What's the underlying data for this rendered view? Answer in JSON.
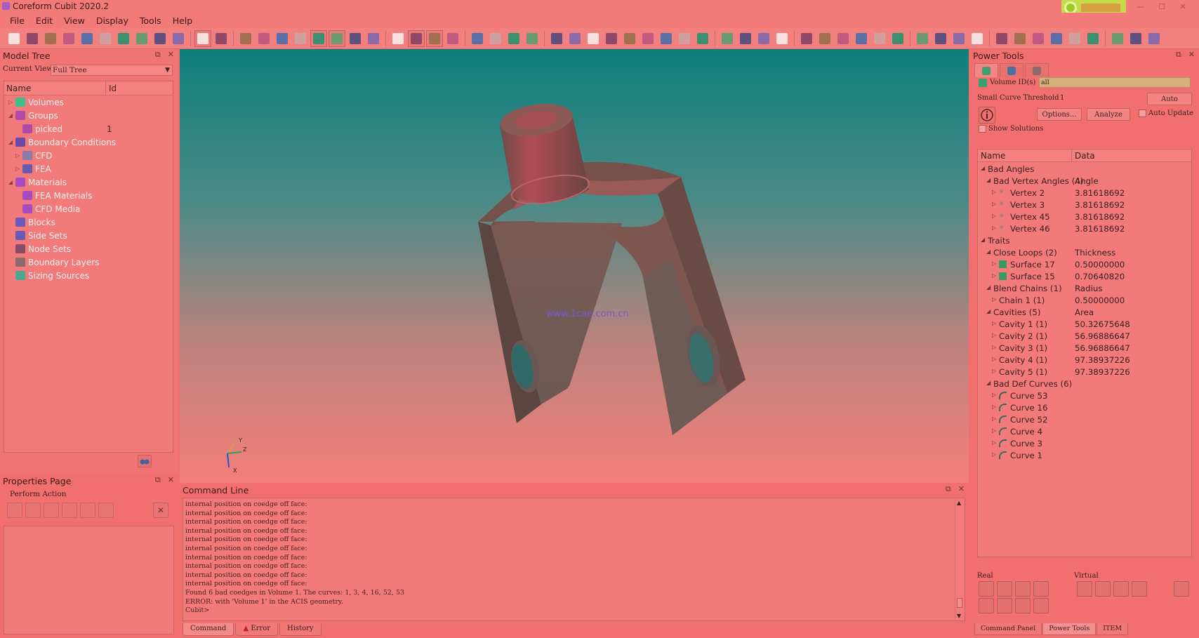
{
  "app": {
    "title": "Coreform Cubit 2020.2"
  },
  "colors": {
    "chrome": "#f27a78",
    "viewport_top": "#0e7f7c",
    "part": "#8b5a52",
    "watermark": "#6d5bd6",
    "highlight_input": "#d5b07a"
  },
  "menu": [
    "File",
    "Edit",
    "View",
    "Display",
    "Tools",
    "Help"
  ],
  "toolbar_icons": [
    "new-file-icon",
    "open-file-icon",
    "save-icon",
    "save-as-icon",
    "export-icon",
    "journal-icon",
    "play-journal-icon",
    "record-icon",
    "stop-icon",
    "settings-icon",
    "select-icon",
    "undo-icon",
    "view-iso-icon",
    "view-front-icon",
    "view-back-icon",
    "view-top-icon",
    "view-bottom-icon",
    "view-left-icon",
    "view-right-icon",
    "view-rotate-icon",
    "mesh-grid-icon",
    "shaded-icon",
    "hidden-line-icon",
    "refresh-icon",
    "zoom-in-icon",
    "zoom-out-icon",
    "fit-icon",
    "perspective-icon",
    "cut-icon",
    "volume-icon",
    "surface-icon",
    "curve-icon",
    "vertex-icon",
    "group-icon",
    "block-icon",
    "sideset-icon",
    "nodeset-icon",
    "pick-volume-icon",
    "pick-surface-icon",
    "pick-curve-icon",
    "pick-vertex-icon",
    "crosshair-icon",
    "line-icon",
    "box-icon",
    "brick-icon",
    "mesh-icon",
    "boundary-icon",
    "axis-icon",
    "arrow-icon",
    "measure-icon",
    "thermo-icon",
    "labels-icon",
    "text-icon",
    "check-icon",
    "minus-icon",
    "dash-icon",
    "fit-window-icon",
    "grid-icon",
    "cube-icon",
    "clear-icon"
  ],
  "model_tree": {
    "title": "Model Tree",
    "current_view_label": "Current View",
    "current_view_value": "Full Tree",
    "columns": [
      "Name",
      "Id"
    ],
    "items": [
      {
        "label": "Volumes",
        "expander": "▷",
        "icon": "volume-icon",
        "color": "#3fbf8a",
        "id": ""
      },
      {
        "label": "Groups",
        "expander": "◢",
        "icon": "group-icon",
        "color": "#b04aa8",
        "id": ""
      },
      {
        "label": "picked",
        "expander": "",
        "icon": "group-icon",
        "color": "#b04aa8",
        "id": "1"
      },
      {
        "label": "Boundary Conditions",
        "expander": "◢",
        "icon": "bc-icon",
        "color": "#6a4aa8",
        "id": ""
      },
      {
        "label": "CFD",
        "expander": "▷",
        "icon": "cfd-icon",
        "color": "#8a7aa8",
        "id": ""
      },
      {
        "label": "FEA",
        "expander": "▷",
        "icon": "fea-icon",
        "color": "#6a5ab0",
        "id": ""
      },
      {
        "label": "Materials",
        "expander": "◢",
        "icon": "materials-icon",
        "color": "#a84ac0",
        "id": ""
      },
      {
        "label": "FEA Materials",
        "expander": "",
        "icon": "fea-material-icon",
        "color": "#a84ac0",
        "id": ""
      },
      {
        "label": "CFD Media",
        "expander": "",
        "icon": "cfd-media-icon",
        "color": "#a84ac0",
        "id": ""
      },
      {
        "label": "Blocks",
        "expander": "",
        "icon": "blocks-icon",
        "color": "#6a5ab8",
        "id": ""
      },
      {
        "label": "Side Sets",
        "expander": "",
        "icon": "sidesets-icon",
        "color": "#6a5ab8",
        "id": ""
      },
      {
        "label": "Node Sets",
        "expander": "",
        "icon": "nodesets-icon",
        "color": "#8a4a6a",
        "id": ""
      },
      {
        "label": "Boundary Layers",
        "expander": "",
        "icon": "boundary-layers-icon",
        "color": "#8a6a6a",
        "id": ""
      },
      {
        "label": "Sizing Sources",
        "expander": "",
        "icon": "sizing-icon",
        "color": "#4aa890",
        "id": ""
      }
    ]
  },
  "properties": {
    "title": "Properties Page",
    "action_label": "Perform Action"
  },
  "viewport": {
    "watermark": "www.1cae.com.cn",
    "axes": {
      "y": "Y",
      "z": "Z",
      "x": "X"
    }
  },
  "command_line": {
    "title": "Command Line",
    "lines": [
      "internal position on coedge off face:",
      "internal position on coedge off face:",
      "internal position on coedge off face:",
      "internal position on coedge off face:",
      "internal position on coedge off face:",
      "internal position on coedge off face:",
      "internal position on coedge off face:",
      "internal position on coedge off face:",
      "internal position on coedge off face:",
      "internal position on coedge off face:",
      "Found 6 bad coedges in Volume 1. The curves: 1, 3, 4, 16, 52, 53",
      "ERROR: with 'Volume 1' in the ACIS geometry.",
      "Cubit>"
    ],
    "tabs": [
      "Command",
      "Error",
      "History"
    ]
  },
  "power_tools": {
    "title": "Power Tools",
    "volume_label": "Volume ID(s)",
    "volume_value": "all",
    "small_curve_label": "Small Curve Threshold",
    "small_curve_value": "1",
    "auto_btn": "Auto",
    "options_btn": "Options...",
    "analyze_btn": "Analyze",
    "auto_update_label": "Auto Update",
    "show_solutions_label": "Show Solutions",
    "columns": [
      "Name",
      "Data"
    ],
    "rows": [
      {
        "name": "Bad Angles",
        "data": "",
        "level": 0,
        "tri": "◢",
        "icon": ""
      },
      {
        "name": "Bad Vertex Angles (4)",
        "data": "Angle",
        "level": 1,
        "tri": "◢",
        "icon": ""
      },
      {
        "name": "Vertex 2",
        "data": "3.81618692",
        "level": 2,
        "tri": "▷",
        "icon": "vertex-icon"
      },
      {
        "name": "Vertex 3",
        "data": "3.81618692",
        "level": 2,
        "tri": "▷",
        "icon": "vertex-icon"
      },
      {
        "name": "Vertex 45",
        "data": "3.81618692",
        "level": 2,
        "tri": "▷",
        "icon": "vertex-icon"
      },
      {
        "name": "Vertex 46",
        "data": "3.81618692",
        "level": 2,
        "tri": "▷",
        "icon": "vertex-icon"
      },
      {
        "name": "Traits",
        "data": "",
        "level": 0,
        "tri": "◢",
        "icon": ""
      },
      {
        "name": "Close Loops (2)",
        "data": "Thickness",
        "level": 1,
        "tri": "◢",
        "icon": ""
      },
      {
        "name": "Surface 17",
        "data": "0.50000000",
        "level": 2,
        "tri": "▷",
        "icon": "surface-icon"
      },
      {
        "name": "Surface 15",
        "data": "0.70640820",
        "level": 2,
        "tri": "▷",
        "icon": "surface-icon"
      },
      {
        "name": "Blend Chains (1)",
        "data": "Radius",
        "level": 1,
        "tri": "◢",
        "icon": ""
      },
      {
        "name": "Chain 1 (1)",
        "data": "0.50000000",
        "level": 2,
        "tri": "▷",
        "icon": ""
      },
      {
        "name": "Cavities (5)",
        "data": "Area",
        "level": 1,
        "tri": "◢",
        "icon": ""
      },
      {
        "name": "Cavity 1 (1)",
        "data": "50.32675648",
        "level": 2,
        "tri": "▷",
        "icon": ""
      },
      {
        "name": "Cavity 2 (1)",
        "data": "56.96886647",
        "level": 2,
        "tri": "▷",
        "icon": ""
      },
      {
        "name": "Cavity 3 (1)",
        "data": "56.96886647",
        "level": 2,
        "tri": "▷",
        "icon": ""
      },
      {
        "name": "Cavity 4 (1)",
        "data": "97.38937226",
        "level": 2,
        "tri": "▷",
        "icon": ""
      },
      {
        "name": "Cavity 5 (1)",
        "data": "97.38937226",
        "level": 2,
        "tri": "▷",
        "icon": ""
      },
      {
        "name": "Bad Def Curves (6)",
        "data": "",
        "level": 1,
        "tri": "◢",
        "icon": ""
      },
      {
        "name": "Curve 53",
        "data": "",
        "level": 2,
        "tri": "▷",
        "icon": "curve-icon"
      },
      {
        "name": "Curve 16",
        "data": "",
        "level": 2,
        "tri": "▷",
        "icon": "curve-icon"
      },
      {
        "name": "Curve 52",
        "data": "",
        "level": 2,
        "tri": "▷",
        "icon": "curve-icon"
      },
      {
        "name": "Curve 4",
        "data": "",
        "level": 2,
        "tri": "▷",
        "icon": "curve-icon"
      },
      {
        "name": "Curve 3",
        "data": "",
        "level": 2,
        "tri": "▷",
        "icon": "curve-icon"
      },
      {
        "name": "Curve 1",
        "data": "",
        "level": 2,
        "tri": "▷",
        "icon": "curve-icon"
      }
    ],
    "real_label": "Real",
    "virtual_label": "Virtual",
    "bottom_tabs": [
      "Command Panel",
      "Power Tools",
      "ITEM"
    ]
  }
}
